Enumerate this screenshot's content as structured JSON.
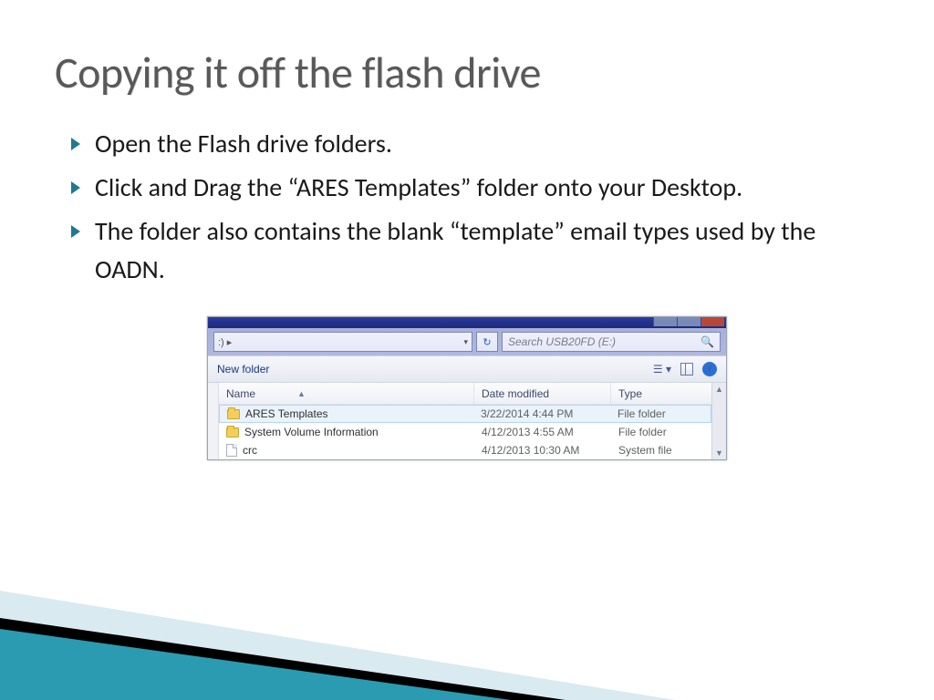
{
  "title": "Copying it off the flash drive",
  "bullets": [
    "Open the Flash drive folders.",
    "Click and Drag the “ARES Templates” folder onto your Desktop.",
    "The folder also contains the blank “template” email types used by the OADN."
  ],
  "explorer": {
    "addr_prefix": ":)  ▸",
    "addr_dropdown": "▾",
    "refresh_glyph": "↻",
    "search_placeholder": "Search USB20FD (E:)",
    "search_icon": "🔍",
    "toolbar": {
      "new_folder": "New folder",
      "view_glyph": "☰ ▾"
    },
    "columns": {
      "name": "Name",
      "date": "Date modified",
      "type": "Type"
    },
    "rows": [
      {
        "name": "ARES Templates",
        "date": "3/22/2014 4:44 PM",
        "type": "File folder",
        "icon": "folder",
        "selected": true
      },
      {
        "name": "System Volume Information",
        "date": "4/12/2013 4:55 AM",
        "type": "File folder",
        "icon": "folder",
        "selected": false
      },
      {
        "name": "crc",
        "date": "4/12/2013 10:30 AM",
        "type": "System file",
        "icon": "file",
        "selected": false
      }
    ]
  }
}
